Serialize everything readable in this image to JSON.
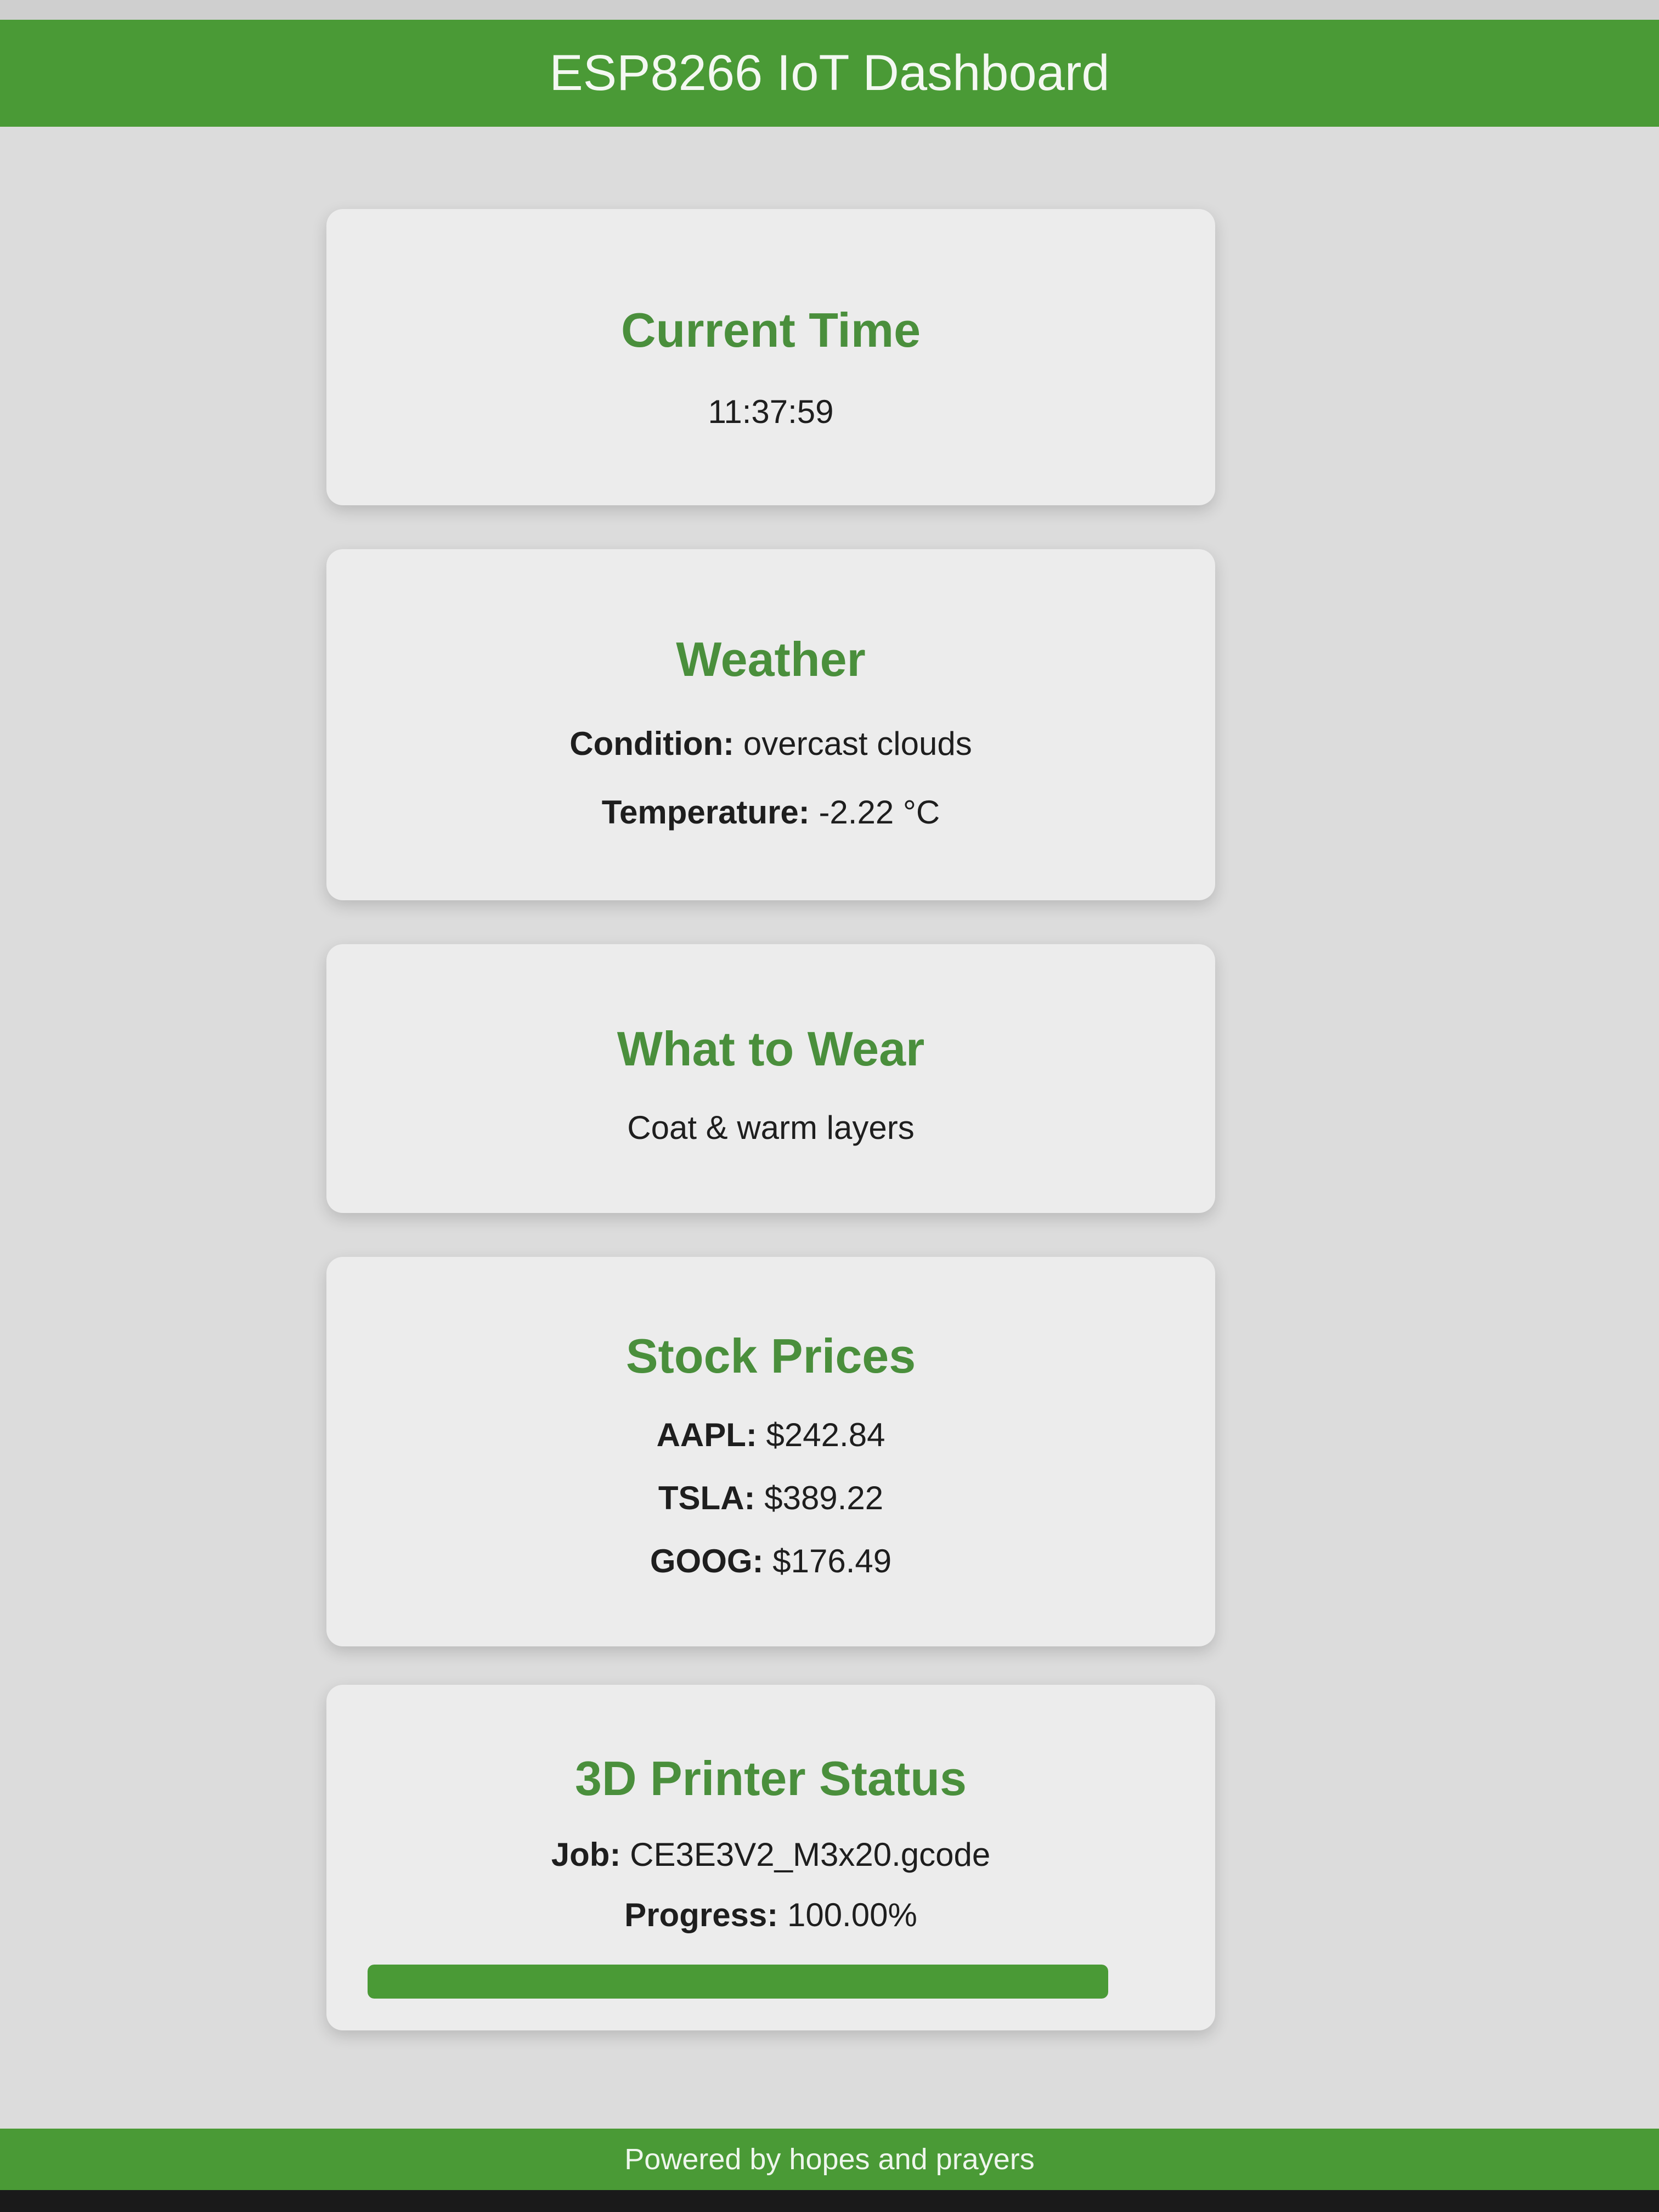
{
  "header": {
    "title": "ESP8266 IoT Dashboard"
  },
  "cards": {
    "time": {
      "title": "Current Time",
      "value": "11:37:59"
    },
    "weather": {
      "title": "Weather",
      "condition_label": "Condition:",
      "condition_value": "overcast clouds",
      "temperature_label": "Temperature:",
      "temperature_value": "-2.22 °C"
    },
    "wear": {
      "title": "What to Wear",
      "value": "Coat & warm layers"
    },
    "stocks": {
      "title": "Stock Prices",
      "items": [
        {
          "symbol": "AAPL:",
          "price": "$242.84"
        },
        {
          "symbol": "TSLA:",
          "price": "$389.22"
        },
        {
          "symbol": "GOOG:",
          "price": "$176.49"
        }
      ]
    },
    "printer": {
      "title": "3D Printer Status",
      "job_label": "Job:",
      "job_value": "CE3E3V2_M3x20.gcode",
      "progress_label": "Progress:",
      "progress_value": "100.00%",
      "progress_fraction": 1.0
    }
  },
  "footer": {
    "text": "Powered by hopes and prayers"
  },
  "colors": {
    "accent": "#4a9a36",
    "card_title": "#4a8f3c",
    "background": "#dcdcdc",
    "card_background": "#ececec"
  }
}
